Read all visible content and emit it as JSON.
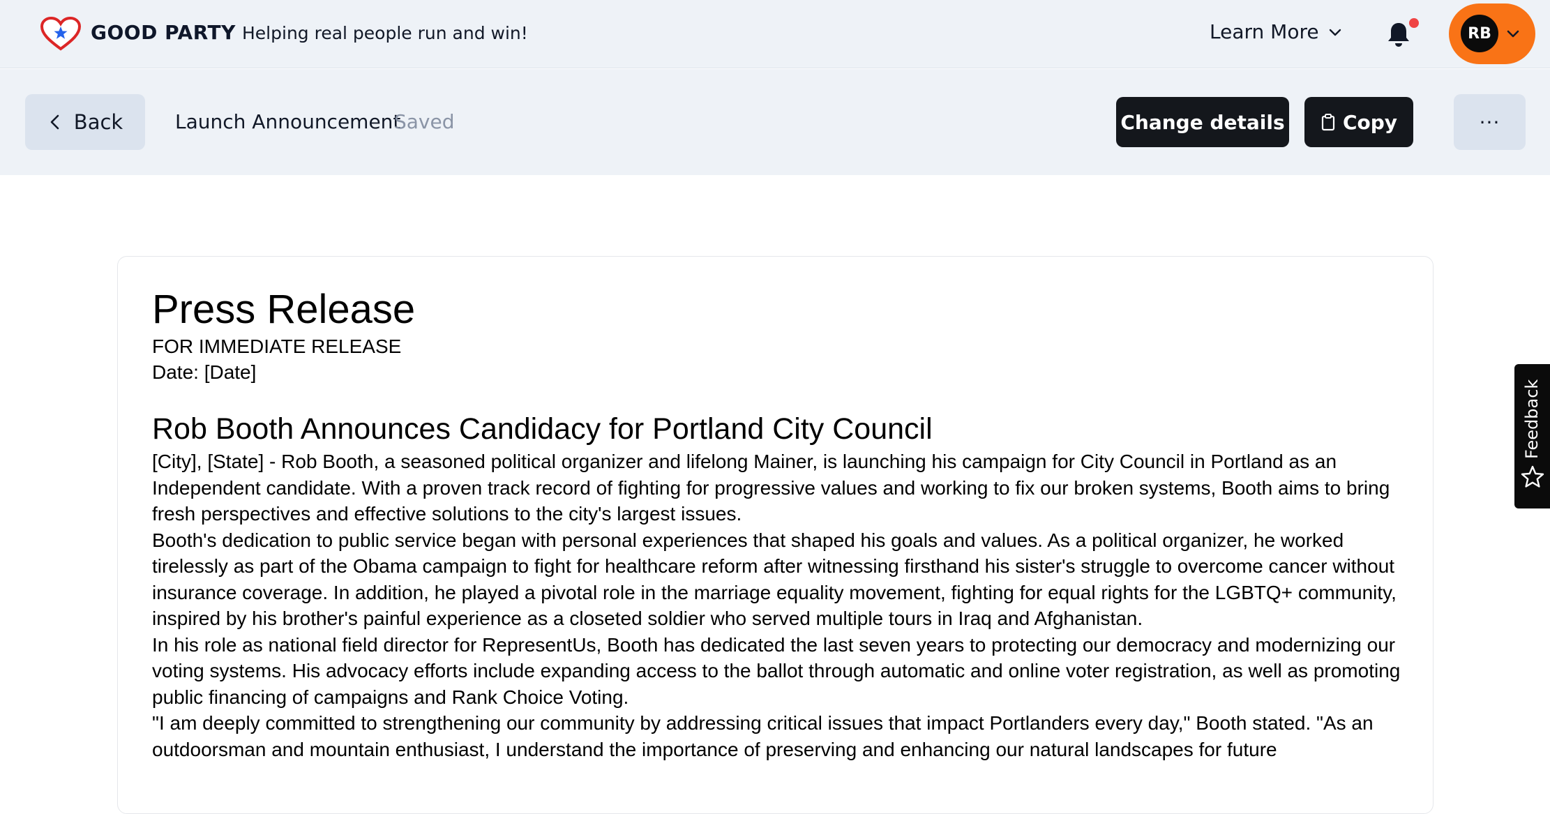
{
  "topnav": {
    "brand": "GOOD PARTY",
    "tagline": "Helping real people run and win!",
    "learn_more": "Learn More",
    "user_initials": "RB",
    "notification_dot_color": "#ef4444",
    "user_pill_color": "#f97316"
  },
  "toolbar": {
    "back_label": "Back",
    "document_title": "Launch Announcement",
    "save_status": "Saved",
    "change_details_label": "Change details",
    "copy_label": "Copy",
    "more_label": "···"
  },
  "document": {
    "heading": "Press Release",
    "release_line": "FOR IMMEDIATE RELEASE",
    "date_line": "Date: [Date]",
    "subheading": "Rob Booth Announces Candidacy for Portland City Council",
    "paragraphs": [
      "[City], [State] - Rob Booth, a seasoned political organizer and lifelong Mainer, is launching his campaign for City Council in Portland as an Independent candidate. With a proven track record of fighting for progressive values and working to fix our broken systems, Booth aims to bring fresh perspectives and effective solutions to the city's largest issues.",
      "Booth's dedication to public service began with personal experiences that shaped his goals and values. As a political organizer, he worked tirelessly as part of the Obama campaign to fight for healthcare reform after witnessing firsthand his sister's struggle to overcome cancer without insurance coverage. In addition, he played a pivotal role in the marriage equality movement, fighting for equal rights for the LGBTQ+ community, inspired by his brother's painful experience as a closeted soldier who served multiple tours in Iraq and Afghanistan.",
      "In his role as national field director for RepresentUs, Booth has dedicated the last seven years to protecting our democracy and modernizing our voting systems. His advocacy efforts include expanding access to the ballot through automatic and online voter registration, as well as promoting public financing of campaigns and Rank Choice Voting.",
      "\"I am deeply committed to strengthening our community by addressing critical issues that impact Portlanders every day,\" Booth stated. \"As an outdoorsman and mountain enthusiast, I understand the importance of preserving and enhancing our natural landscapes for future"
    ]
  },
  "feedback": {
    "label": "Feedback"
  }
}
